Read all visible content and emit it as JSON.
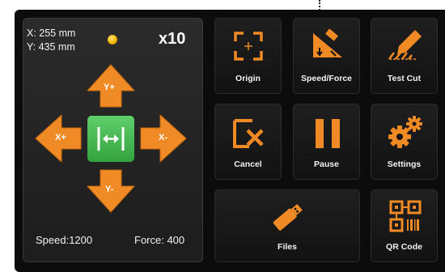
{
  "status": {
    "x_position": "X: 255 mm",
    "y_position": "Y: 435 mm",
    "zoom": "x10"
  },
  "jog": {
    "up_label": "Y+",
    "down_label": "Y-",
    "left_label": "X+",
    "right_label": "X-",
    "center_icon": "horizontal-resize-icon"
  },
  "settings_bar": {
    "speed": "Speed:1200",
    "force": "Force: 400"
  },
  "tiles": {
    "origin": {
      "label": "Origin",
      "icon": "origin-crosshair-icon"
    },
    "speed_force": {
      "label": "Speed/Force",
      "icon": "speed-force-icon"
    },
    "test_cut": {
      "label": "Test Cut",
      "icon": "test-cut-blade-icon"
    },
    "cancel": {
      "label": "Cancel",
      "icon": "cancel-x-icon"
    },
    "pause": {
      "label": "Pause",
      "icon": "pause-icon"
    },
    "settings": {
      "label": "Settings",
      "icon": "gears-icon"
    },
    "files": {
      "label": "Files",
      "icon": "usb-drive-icon"
    },
    "qr_code": {
      "label": "QR Code",
      "icon": "qr-code-icon"
    }
  },
  "colors": {
    "accent_orange": "#F08A24",
    "center_green": "#3DB548",
    "background": "#0C0C0C",
    "text": "#F2F2F2"
  }
}
